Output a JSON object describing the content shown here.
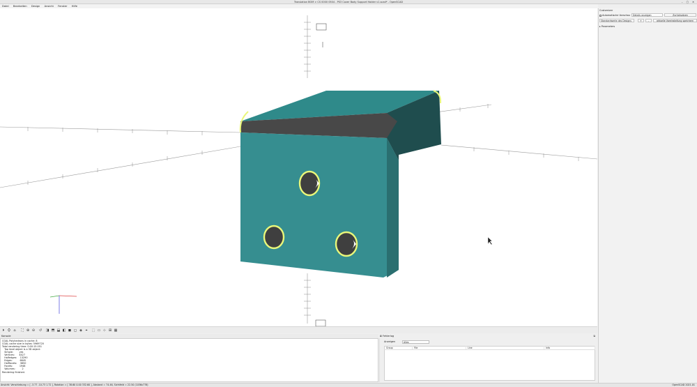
{
  "window": {
    "title": "Translation BOM > CS 0000 0504 - PS3 Cover Body Support Holder v1.scad* - OpenSCAD",
    "controls": "–  ▢  ✕"
  },
  "menu": [
    "Datei",
    "Bearbeiten",
    "Design",
    "Ansicht",
    "Fenster",
    "Hilfe"
  ],
  "customizer": {
    "title": "Customizer",
    "auto_preview_label": "Automatische Vorschau",
    "details_select": "Details anzeigen",
    "reset_button": "Zurücksetzen",
    "preset_select": "Standardwerte des Designs",
    "add_button": "+",
    "remove_button": "-",
    "save_preset_button": "aktuelle Voreinstellung speichern",
    "parameters_section": "Parameters"
  },
  "console": {
    "title": "Konsole",
    "lines": [
      "CGAL Polyhedrons in cache: 8",
      "CGAL cache size in bytes: 5969720",
      "Total rendering time: 0:00:15.051",
      "   Top level object is a 3D object:",
      "   Simple:        yes",
      "   Vertices:      4427",
      "   Halfedges:    13290",
      "   Edges:          6645",
      "   Halffacets:    3850",
      "   Facets:         1948",
      "   Volumes:         2",
      "Rendering finished."
    ]
  },
  "error_log": {
    "title": "Fehlerlog",
    "show_label": "Anzeigen",
    "filter_value": "Alles",
    "columns": [
      "Group",
      "File",
      "Line",
      "Info"
    ]
  },
  "statusbar": {
    "left": "Ansicht: Verschiebung = [ -3.77 -10.73 1.72 ], Rotation = [ 38.60 0.00 332.60 ], Abstand = 74.46, Sichtfeld = 22.50 (1036x778)",
    "right": "OpenSCAD 2021.01"
  },
  "icons": [
    "preview-icon",
    "render-icon",
    "export-stl-icon",
    "zoom-all-icon",
    "zoom-in-icon",
    "zoom-out-icon",
    "reset-view-icon",
    "view-right-icon",
    "view-top-icon",
    "view-bottom-icon",
    "view-left-icon",
    "view-front-icon",
    "view-back-icon",
    "view-diagonal-icon",
    "view-center-icon",
    "perspective-icon",
    "orthogonal-icon",
    "show-axes-icon",
    "show-scale-icon",
    "show-edges-icon"
  ],
  "colors": {
    "model_face": "#368e90",
    "model_side": "#1f4d4e",
    "model_top": "#2f8a8a",
    "dark_face": "#484848",
    "highlight": "#e9f77a"
  }
}
